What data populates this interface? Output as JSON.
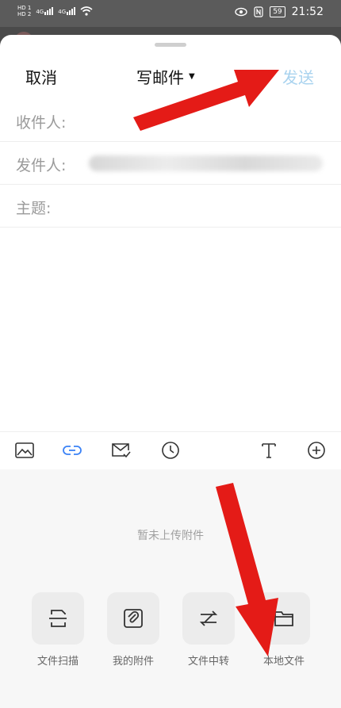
{
  "status_bar": {
    "time": "21:52",
    "battery": "59",
    "network_1": "4G",
    "network_2": "4G",
    "sim_1": "HD 1",
    "sim_2": "HD 2"
  },
  "header": {
    "cancel_label": "取消",
    "title": "写邮件",
    "send_label": "发送"
  },
  "fields": {
    "to_label": "收件人:",
    "from_label": "发件人:",
    "subject_label": "主题:"
  },
  "toolbar": {
    "icons": [
      "image-icon",
      "link-icon",
      "mail-check-icon",
      "clock-icon",
      "text-format-icon",
      "add-icon"
    ]
  },
  "attachments": {
    "empty_text": "暂未上传附件",
    "items": [
      {
        "label": "文件扫描",
        "icon": "scan-document-icon"
      },
      {
        "label": "我的附件",
        "icon": "attachment-icon"
      },
      {
        "label": "文件中转",
        "icon": "transfer-icon"
      },
      {
        "label": "本地文件",
        "icon": "folder-icon"
      }
    ]
  },
  "colors": {
    "send_disabled": "#a9d3ef",
    "accent": "#3b82f6",
    "arrow": "#e41b17"
  }
}
